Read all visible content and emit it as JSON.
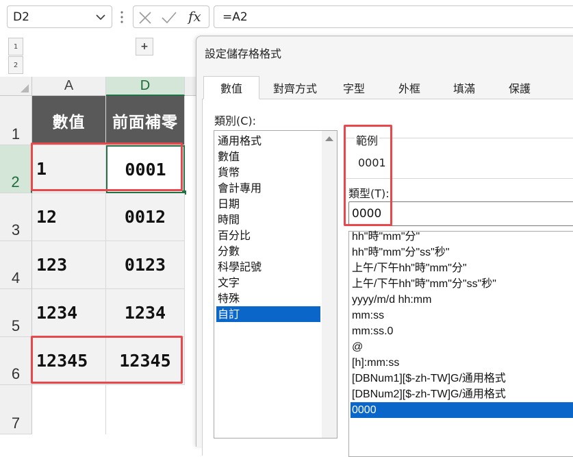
{
  "formula_bar": {
    "name_box": "D2",
    "fx_label": "fx",
    "formula": "=A2"
  },
  "outline": {
    "level_buttons": [
      "1",
      "2"
    ],
    "expand_label": "+"
  },
  "sheet": {
    "columns": [
      "A",
      "D"
    ],
    "rows": [
      "1",
      "2",
      "3",
      "4",
      "5",
      "6",
      "7"
    ],
    "header": [
      "數值",
      "前面補零"
    ],
    "data": [
      [
        "1",
        "0001"
      ],
      [
        "12",
        "0012"
      ],
      [
        "123",
        "0123"
      ],
      [
        "1234",
        "1234"
      ],
      [
        "12345",
        "12345"
      ]
    ]
  },
  "dialog": {
    "title": "設定儲存格格式",
    "tabs": [
      "數值",
      "對齊方式",
      "字型",
      "外框",
      "填滿",
      "保護"
    ],
    "active_tab": "數值",
    "category_label": "類別(C):",
    "categories": [
      "通用格式",
      "數值",
      "貨幣",
      "會計專用",
      "日期",
      "時間",
      "百分比",
      "分數",
      "科學記號",
      "文字",
      "特殊",
      "自訂"
    ],
    "selected_category": "自訂",
    "sample_label": "範例",
    "sample_value": "0001",
    "type_label": "類型(T):",
    "type_value": "0000",
    "formats": [
      "hh\"時\"mm\"分\"",
      "hh\"時\"mm\"分\"ss\"秒\"",
      "上午/下午hh\"時\"mm\"分\"",
      "上午/下午hh\"時\"mm\"分\"ss\"秒\"",
      "yyyy/m/d hh:mm",
      "mm:ss",
      "mm:ss.0",
      "@",
      "[h]:mm:ss",
      "[DBNum1][$-zh-TW]G/通用格式",
      "[DBNum2][$-zh-TW]G/通用格式",
      "0000"
    ],
    "selected_format": "0000"
  },
  "colors": {
    "excel_green": "#217346",
    "highlight_red": "#e8474c",
    "selection_blue": "#0a66c8",
    "header_fill": "#595959"
  }
}
